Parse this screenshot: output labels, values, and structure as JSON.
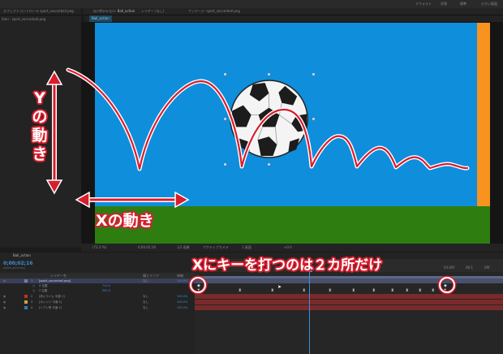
{
  "top_menu": {
    "left_text": "",
    "items": [
      "デフォルト",
      "学習",
      "標準",
      "小さい画面"
    ]
  },
  "panel_headers": {
    "effect_controls": "エフェクトコントロール sport_soccerball.png",
    "comp_tab": "コンポジション: Ball_action",
    "layer_tab": "レイヤー (なし)",
    "footage_tab": "フッテージ: sport_soccerball.png"
  },
  "left_panel": {
    "label": "ition : sport_soccerball.png"
  },
  "viewer": {
    "tab_label": "Ball_action",
    "zoom": "(72.3 %)",
    "timecode": "0;00;02;16",
    "resolution": "1/2 画質",
    "camera": "アクティブカメラ",
    "views": "1 画面",
    "extra": "+0.0"
  },
  "timeline": {
    "comp_name": "Ball_action",
    "timecode": "0;00;02;16",
    "sub": "00076 (29.97 fps)",
    "columns": {
      "name": "レイヤー名",
      "parent": "親とリンク",
      "stretch": "伸縮"
    },
    "layers": [
      {
        "num": "1",
        "name": "[sport_soccerball.png]",
        "parent": "なし",
        "stretch": "100.0%",
        "color": "#7a7ab0",
        "selected": true
      },
      {
        "num": "",
        "name": "X 位置",
        "value": "724.0",
        "sub": true
      },
      {
        "num": "",
        "name": "Y 位置",
        "value": "562.0",
        "sub": true
      },
      {
        "num": "2",
        "name": "[赤いライム 平面 1]",
        "parent": "なし",
        "stretch": "100.0%",
        "color": "#c0302a"
      },
      {
        "num": "3",
        "name": "[オレンジ 平面 1]",
        "parent": "なし",
        "stretch": "100.0%",
        "color": "#d8a13a"
      },
      {
        "num": "4",
        "name": "[シアン青 平面 1]",
        "parent": "なし",
        "stretch": "100.0%",
        "color": "#2a7fb0"
      }
    ],
    "ruler_ticks": [
      "00f",
      "03:00f",
      "06:1",
      "09f"
    ]
  },
  "annotations": {
    "x_motion": "Xの動き",
    "y_motion": "Yの動き",
    "keys_note": "Xにキーを打つのは２カ所だけ"
  },
  "colors": {
    "sky": "#0e8edb",
    "orange_bar": "#f7931e",
    "grass": "#2e7d10",
    "annotation_red": "#d81d2c",
    "cti_blue": "#3d8fe0"
  }
}
